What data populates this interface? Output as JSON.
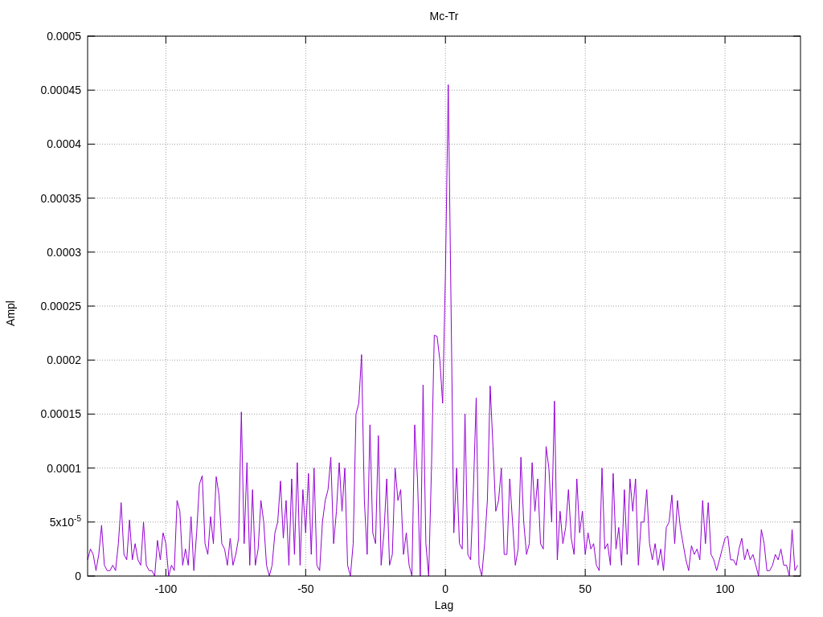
{
  "chart": {
    "chart_data": {
      "type": "line",
      "title": "Mc-Tr",
      "xlabel": "Lag",
      "ylabel": "Ampl",
      "x": [
        -128,
        -127,
        -126,
        -125,
        -124,
        -123,
        -122,
        -121,
        -120,
        -119,
        -118,
        -117,
        -116,
        -115,
        -114,
        -113,
        -112,
        -111,
        -110,
        -109,
        -108,
        -107,
        -106,
        -105,
        -104,
        -103,
        -102,
        -101,
        -100,
        -99,
        -98,
        -97,
        -96,
        -95,
        -94,
        -93,
        -92,
        -91,
        -90,
        -89,
        -88,
        -87,
        -86,
        -85,
        -84,
        -83,
        -82,
        -81,
        -80,
        -79,
        -78,
        -77,
        -76,
        -75,
        -74,
        -73,
        -72,
        -71,
        -70,
        -69,
        -68,
        -67,
        -66,
        -65,
        -64,
        -63,
        -62,
        -61,
        -60,
        -59,
        -58,
        -57,
        -56,
        -55,
        -54,
        -53,
        -52,
        -51,
        -50,
        -49,
        -48,
        -47,
        -46,
        -45,
        -44,
        -43,
        -42,
        -41,
        -40,
        -39,
        -38,
        -37,
        -36,
        -35,
        -34,
        -33,
        -32,
        -31,
        -30,
        -29,
        -28,
        -27,
        -26,
        -25,
        -24,
        -23,
        -22,
        -21,
        -20,
        -19,
        -18,
        -17,
        -16,
        -15,
        -14,
        -13,
        -12,
        -11,
        -10,
        -9,
        -8,
        -7,
        -6,
        -5,
        -4,
        -3,
        -2,
        -1,
        0,
        1,
        2,
        3,
        4,
        5,
        6,
        7,
        8,
        9,
        10,
        11,
        12,
        13,
        14,
        15,
        16,
        17,
        18,
        19,
        20,
        21,
        22,
        23,
        24,
        25,
        26,
        27,
        28,
        29,
        30,
        31,
        32,
        33,
        34,
        35,
        36,
        37,
        38,
        39,
        40,
        41,
        42,
        43,
        44,
        45,
        46,
        47,
        48,
        49,
        50,
        51,
        52,
        53,
        54,
        55,
        56,
        57,
        58,
        59,
        60,
        61,
        62,
        63,
        64,
        65,
        66,
        67,
        68,
        69,
        70,
        71,
        72,
        73,
        74,
        75,
        76,
        77,
        78,
        79,
        80,
        81,
        82,
        83,
        84,
        85,
        86,
        87,
        88,
        89,
        90,
        91,
        92,
        93,
        94,
        95,
        96,
        97,
        98,
        99,
        100,
        101,
        102,
        103,
        104,
        105,
        106,
        107,
        108,
        109,
        110,
        111,
        112,
        113,
        114,
        115,
        116,
        117,
        118,
        119,
        120,
        121,
        122,
        123,
        124,
        125,
        126
      ],
      "series": [
        {
          "color": "#9400d3",
          "values": [
            1.5e-05,
            2.5e-05,
            2e-05,
            5e-06,
            2e-05,
            4.7e-05,
            1e-05,
            5e-06,
            5e-06,
            1e-05,
            5e-06,
            3e-05,
            6.8e-05,
            2e-05,
            1.5e-05,
            5.2e-05,
            1.5e-05,
            3e-05,
            1.5e-05,
            1e-05,
            5e-05,
            1e-05,
            5e-06,
            5e-06,
            0,
            3.3e-05,
            1.5e-05,
            4e-05,
            3e-05,
            0,
            1e-05,
            5e-06,
            7e-05,
            6e-05,
            1e-05,
            2.5e-05,
            1e-05,
            5.5e-05,
            5e-06,
            4e-05,
            8.5e-05,
            9.3e-05,
            3e-05,
            2e-05,
            5.5e-05,
            3e-05,
            9.2e-05,
            7.5e-05,
            3e-05,
            2.5e-05,
            1e-05,
            3.5e-05,
            1e-05,
            2e-05,
            3.5e-05,
            0.000152,
            3e-05,
            0.000105,
            1e-05,
            8e-05,
            1e-05,
            2.5e-05,
            7e-05,
            5e-05,
            1e-05,
            0,
            1e-05,
            4e-05,
            5e-05,
            8.8e-05,
            3.5e-05,
            7e-05,
            1e-05,
            9e-05,
            2e-05,
            0.000105,
            1e-05,
            8e-05,
            4e-05,
            9.5e-05,
            2e-05,
            0.0001,
            1e-05,
            5e-06,
            5e-05,
            7e-05,
            8e-05,
            0.00011,
            3e-05,
            6e-05,
            0.000105,
            6e-05,
            0.0001,
            1e-05,
            0,
            3e-05,
            0.00015,
            0.00016,
            0.000205,
            7e-05,
            2e-05,
            0.00014,
            4e-05,
            3e-05,
            0.00013,
            1e-05,
            4e-05,
            9e-05,
            1e-05,
            2e-05,
            0.0001,
            7e-05,
            8e-05,
            2e-05,
            4e-05,
            1e-05,
            0,
            0.00014,
            9e-05,
            0,
            0.000177,
            3e-05,
            0,
            0.0001,
            0.000223,
            0.000222,
            0.0002,
            0.00016,
            0.00028,
            0.000455,
            0.00025,
            4e-05,
            0.0001,
            3e-05,
            2.5e-05,
            0.00015,
            2e-05,
            1.5e-05,
            8e-05,
            0.000165,
            1e-05,
            0,
            3e-05,
            7e-05,
            0.000176,
            0.00012,
            6e-05,
            7e-05,
            0.0001,
            2e-05,
            2e-05,
            9e-05,
            5e-05,
            1e-05,
            2.5e-05,
            0.00011,
            5e-05,
            2e-05,
            3e-05,
            0.000105,
            6e-05,
            9e-05,
            3e-05,
            2.5e-05,
            0.00012,
            0.0001,
            5e-05,
            0.000162,
            1.5e-05,
            6e-05,
            3e-05,
            4.5e-05,
            8e-05,
            3.5e-05,
            2e-05,
            9e-05,
            4e-05,
            6e-05,
            2e-05,
            4e-05,
            2.5e-05,
            3e-05,
            1e-05,
            5e-06,
            0.0001,
            2.5e-05,
            3e-05,
            1e-05,
            9.5e-05,
            2.5e-05,
            4.5e-05,
            1e-05,
            8e-05,
            2e-05,
            9e-05,
            6e-05,
            9e-05,
            1e-05,
            5e-05,
            5e-05,
            8e-05,
            3e-05,
            1.5e-05,
            3e-05,
            1e-05,
            2.5e-05,
            5e-06,
            4.5e-05,
            5e-05,
            7.5e-05,
            3e-05,
            7e-05,
            4.5e-05,
            3e-05,
            1.5e-05,
            5e-06,
            2.8e-05,
            2e-05,
            2.5e-05,
            1.5e-05,
            7e-05,
            3e-05,
            6.8e-05,
            2e-05,
            1.5e-05,
            5e-06,
            1.5e-05,
            2.5e-05,
            3.5e-05,
            3.7e-05,
            1.5e-05,
            1.5e-05,
            1e-05,
            2.5e-05,
            3.5e-05,
            1.5e-05,
            2.5e-05,
            1.5e-05,
            2e-05,
            1e-05,
            0,
            4.3e-05,
            3e-05,
            5e-06,
            5e-06,
            1e-05,
            2e-05,
            1.5e-05,
            2.5e-05,
            1e-05,
            1e-05,
            0,
            4.3e-05,
            5e-06,
            1e-05
          ]
        }
      ],
      "grid": true,
      "xlim": [
        -128,
        127
      ],
      "ylim": [
        0,
        0.0005
      ],
      "xticks": [
        {
          "value": -100,
          "label": "-100"
        },
        {
          "value": -50,
          "label": "-50"
        },
        {
          "value": 0,
          "label": "0"
        },
        {
          "value": 50,
          "label": "50"
        },
        {
          "value": 100,
          "label": "100"
        }
      ],
      "yticks": [
        {
          "value": 0,
          "label": "0"
        },
        {
          "value": 5e-05,
          "label": "5x10$^{-5}$"
        },
        {
          "value": 0.0001,
          "label": "0.0001"
        },
        {
          "value": 0.00015,
          "label": "0.00015"
        },
        {
          "value": 0.0002,
          "label": "0.0002"
        },
        {
          "value": 0.00025,
          "label": "0.00025"
        },
        {
          "value": 0.0003,
          "label": "0.0003"
        },
        {
          "value": 0.00035,
          "label": "0.00035"
        },
        {
          "value": 0.0004,
          "label": "0.0004"
        },
        {
          "value": 0.00045,
          "label": "0.00045"
        },
        {
          "value": 0.0005,
          "label": "0.0005"
        }
      ]
    }
  }
}
